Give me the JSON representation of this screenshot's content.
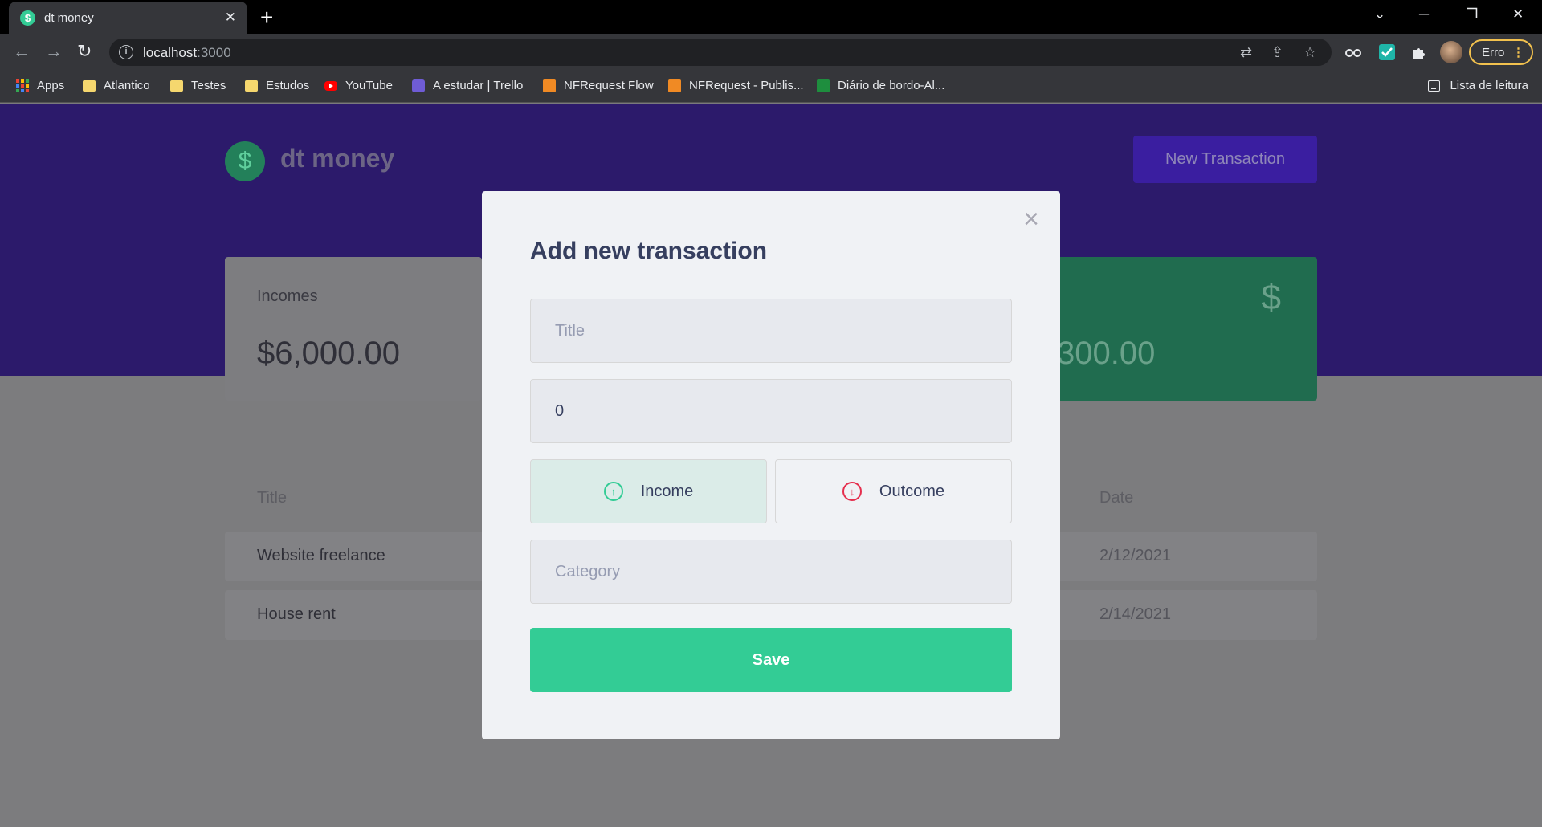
{
  "browser": {
    "tab_title": "dt money",
    "tab_favicon": "$",
    "tab_close": "✕",
    "new_tab": "+",
    "url_host": "localhost",
    "url_port": ":3000",
    "profile_status": "Erro",
    "window_controls": {
      "dropdown": "⌄",
      "minimize": "─",
      "restore": "❐",
      "close": "✕"
    },
    "nav": {
      "back": "←",
      "forward": "→",
      "reload": "↻"
    },
    "bookmarks": [
      {
        "label": "Apps",
        "icon": "apps-grid-icon"
      },
      {
        "label": "Atlantico",
        "icon": "folder-icon"
      },
      {
        "label": "Testes",
        "icon": "folder-icon"
      },
      {
        "label": "Estudos",
        "icon": "folder-icon"
      },
      {
        "label": "YouTube",
        "icon": "youtube-icon"
      },
      {
        "label": "A estudar | Trello",
        "icon": "trello-icon"
      },
      {
        "label": "NFRequest Flow",
        "icon": "nfrequest-icon"
      },
      {
        "label": "NFRequest - Publis...",
        "icon": "nfrequest-icon"
      },
      {
        "label": "Diário de bordo-Al...",
        "icon": "sheets-icon"
      }
    ],
    "reading_list": "Lista de leitura"
  },
  "app": {
    "logo_symbol": "$",
    "logo_text": "dt money",
    "new_transaction_label": "New Transaction",
    "summary": {
      "income_label": "Incomes",
      "income_value": "$6,000.00",
      "total_icon": "$",
      "total_value_visible": "300.00"
    },
    "table": {
      "headers": {
        "title": "Title",
        "date": "Date"
      },
      "rows": [
        {
          "title": "Website freelance",
          "date": "2/12/2021"
        },
        {
          "title": "House rent",
          "date": "2/14/2021"
        }
      ]
    }
  },
  "modal": {
    "title": "Add new transaction",
    "close_icon": "×",
    "title_placeholder": "Title",
    "amount_value": "0",
    "income_label": "Income",
    "outcome_label": "Outcome",
    "income_icon": "↑",
    "outcome_icon": "↓",
    "category_placeholder": "Category",
    "save_label": "Save",
    "selected_type": "income"
  },
  "colors": {
    "brand_green": "#33cc95",
    "brand_red": "#e52e4d",
    "brand_purple": "#5429cc",
    "text_title": "#363f5f"
  }
}
